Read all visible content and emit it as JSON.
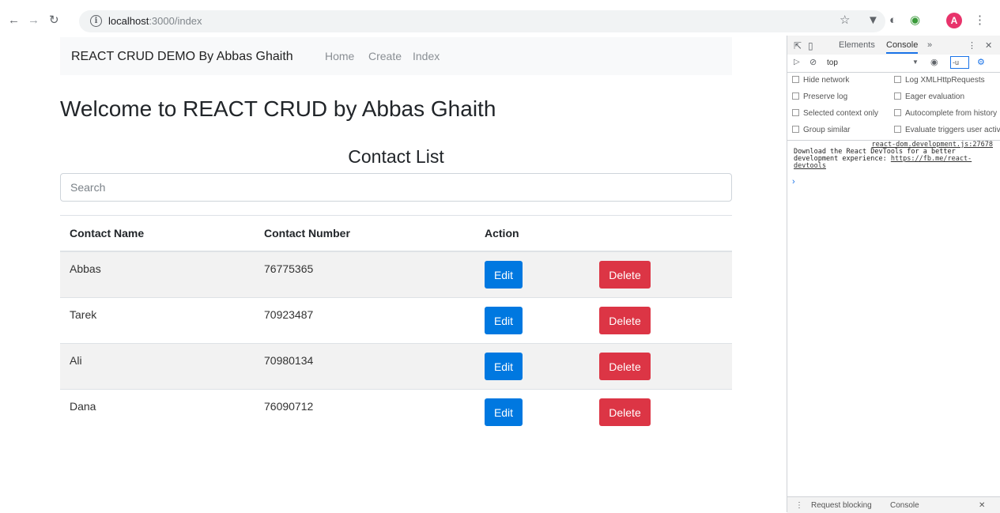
{
  "browser": {
    "url_host": "localhost",
    "url_path": ":3000/index",
    "avatar_letter": "A"
  },
  "navbar": {
    "brand": "REACT CRUD DEMO By Abbas Ghaith",
    "links": [
      "Home",
      "Create",
      "Index"
    ]
  },
  "page": {
    "heading": "Welcome to REACT CRUD by Abbas Ghaith",
    "list_title": "Contact List",
    "search_placeholder": "Search"
  },
  "table": {
    "headers": [
      "Contact Name",
      "Contact Number",
      "Action"
    ],
    "edit_label": "Edit",
    "delete_label": "Delete",
    "rows": [
      {
        "name": "Abbas",
        "number": "76775365"
      },
      {
        "name": "Tarek",
        "number": "70923487"
      },
      {
        "name": "Ali",
        "number": "70980134"
      },
      {
        "name": "Dana",
        "number": "76090712"
      }
    ]
  },
  "devtools": {
    "tabs": [
      "Elements",
      "Console"
    ],
    "context": "top",
    "filter": "-u",
    "settings": [
      "Hide network",
      "Log XMLHttpRequests",
      "Preserve log",
      "Eager evaluation",
      "Selected context only",
      "Autocomplete from history",
      "Group similar",
      "Evaluate triggers user activation"
    ],
    "message_source": "react-dom.development.js:27678",
    "message_text": "Download the React DevTools for a better development experience: ",
    "message_link": "https://fb.me/react-devtools",
    "drawer_tabs": [
      "Request blocking",
      "Console"
    ]
  },
  "colors": {
    "primary": "#0078e0",
    "danger": "#dc3545",
    "avatar": "#e8336b"
  }
}
